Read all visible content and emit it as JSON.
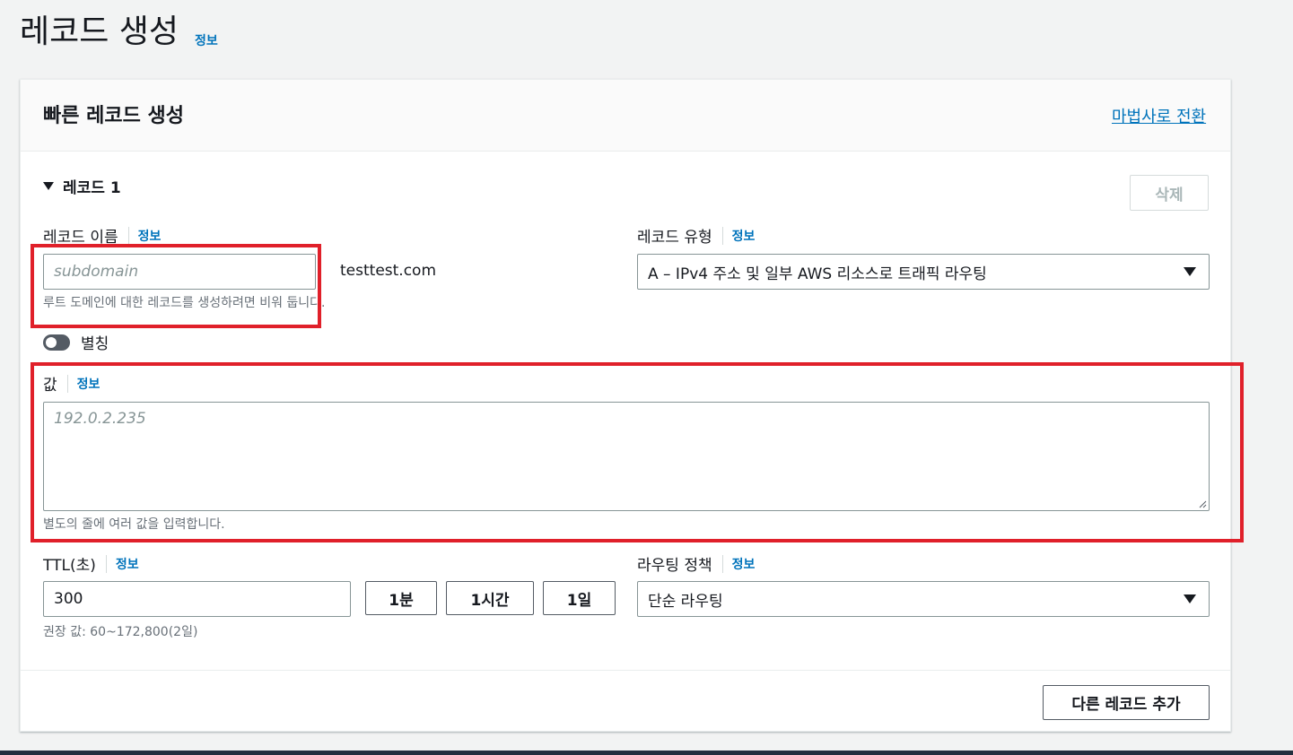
{
  "page": {
    "title": "레코드 생성",
    "info": "정보"
  },
  "panel": {
    "title": "빠른 레코드 생성",
    "wizard_link": "마법사로 전환"
  },
  "record": {
    "header": "레코드 1",
    "delete_label": "삭제",
    "name": {
      "label": "레코드 이름",
      "info": "정보",
      "placeholder": "subdomain",
      "suffix": "testtest.com",
      "hint": "루트 도메인에 대한 레코드를 생성하려면 비워 둡니다."
    },
    "type": {
      "label": "레코드 유형",
      "info": "정보",
      "selected": "A – IPv4 주소 및 일부 AWS 리소스로 트래픽 라우팅"
    },
    "alias": {
      "label": "별칭",
      "enabled": false
    },
    "value": {
      "label": "값",
      "info": "정보",
      "placeholder": "192.0.2.235",
      "hint": "별도의 줄에 여러 값을 입력합니다."
    },
    "ttl": {
      "label": "TTL(초)",
      "info": "정보",
      "value": "300",
      "presets": [
        "1분",
        "1시간",
        "1일"
      ],
      "hint": "권장 값: 60~172,800(2일)"
    },
    "routing": {
      "label": "라우팅 정책",
      "info": "정보",
      "selected": "단순 라우팅"
    }
  },
  "footer": {
    "add_record_label": "다른 레코드 추가"
  },
  "colors": {
    "link": "#0073bb",
    "highlight": "#e0202a",
    "border": "#879596"
  }
}
